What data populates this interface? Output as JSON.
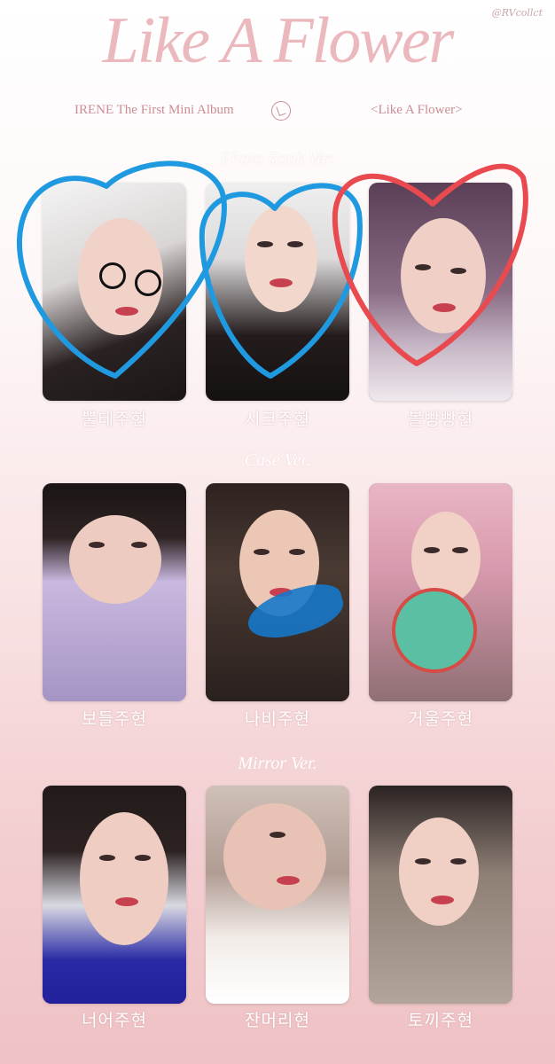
{
  "watermark": "@RVcollct",
  "header": {
    "title": "Like A Flower",
    "artist_line": "IRENE   The First Mini Album",
    "album_line": "<Like A Flower>"
  },
  "sections": [
    {
      "label": "Photo Book Ver.",
      "cards": [
        {
          "caption": "뿔테주현"
        },
        {
          "caption": "시크주현"
        },
        {
          "caption": "볼빵빵현"
        }
      ]
    },
    {
      "label": "Case Ver.",
      "cards": [
        {
          "caption": "보들주현"
        },
        {
          "caption": "나비주현"
        },
        {
          "caption": "거울주현"
        }
      ]
    },
    {
      "label": "Mirror Ver.",
      "cards": [
        {
          "caption": "너어주현"
        },
        {
          "caption": "잔머리현"
        },
        {
          "caption": "토끼주현"
        }
      ]
    }
  ],
  "colors": {
    "heart_blue": "#1f9ae0",
    "heart_red": "#e84a4f",
    "title_pink": "#eab8bd"
  }
}
